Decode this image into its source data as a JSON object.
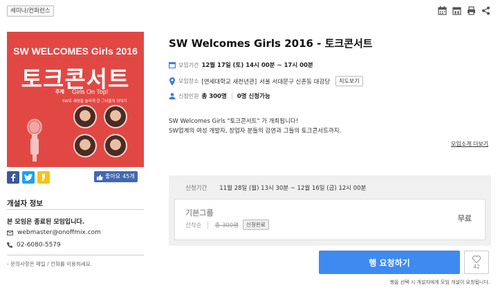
{
  "category_tag": "세미나/컨퍼런스",
  "top_icons": [
    "calendar-icon",
    "calendar-31-icon",
    "print-icon",
    "share-icon"
  ],
  "poster": {
    "subtitle": "SW WELCOMES Girls 2016",
    "main_text": "토크콘서트",
    "theme_label": "주제",
    "theme": "Girls On Top!",
    "theme_desc": "SW로 세상을 놀라게 한 그녀들의 이야기"
  },
  "share": {
    "buttons": [
      "facebook-icon",
      "twitter-icon",
      "kakaostory-icon"
    ],
    "like_label": "좋아요",
    "like_count": "45개"
  },
  "organizer": {
    "title": "개설자 정보",
    "ended_text": "본 모임은 종료된 모임입니다.",
    "email": "webmaster@onoffmix.com",
    "phone": "02-6080-5579",
    "note": "- 문의사항은 메일 / 전화를 이용하세요."
  },
  "event": {
    "title": "SW Welcomes Girls 2016 - 토크콘서트",
    "date_label": "모임기간",
    "date": "12월 17일 (토) 14시 00분 ~ 17시 00분",
    "place_label": "모임장소",
    "place_venue": "[연세대학교 새천년관]",
    "place_address": "서울 서대문구 신촌동 대강당",
    "map_button": "지도보기",
    "capacity_label": "신청인원",
    "capacity": "총 300명",
    "applied": "0명 신청가능",
    "desc_line1": "SW Welcomes Girls \"토크콘서트\" 가 개최됩니다!",
    "desc_line2": "SW업계의 여성 개발자, 창업자 분들의 강연과 그들의 토크콘서트까지.",
    "intro_more": "모임소개 더보기"
  },
  "application": {
    "period_label": "신청기간",
    "period": "11월 28일 (월) 13시 30분 ~ 12월 16일 (금) 12시 00분",
    "ticket_name": "기본그룹",
    "ticket_type": "선착순",
    "ticket_total": "총 300명",
    "ticket_status": "신청완료",
    "price": "무료",
    "request_button": "행 요청하기",
    "heart_count": "42",
    "bottom_note": "행을 선택 시 개설자에게 모임 개설이 요청됩니다."
  },
  "colors": {
    "poster_red": "#e14844",
    "accent_blue": "#3e8af0",
    "facebook": "#3b5998",
    "twitter": "#1da1f2",
    "kakao": "#f7c21a"
  }
}
